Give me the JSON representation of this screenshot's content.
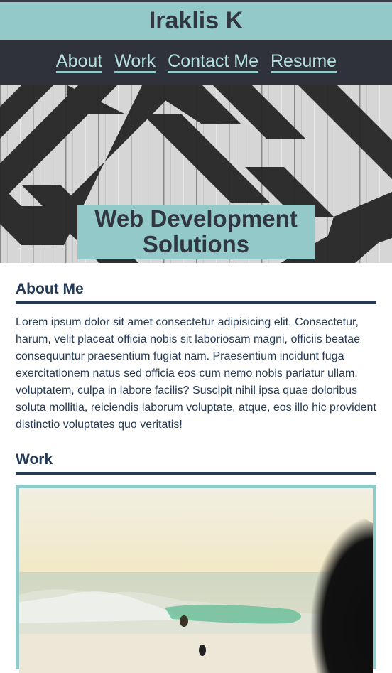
{
  "site": {
    "title": "Iraklis K"
  },
  "nav": {
    "items": [
      {
        "label": "About"
      },
      {
        "label": "Work"
      },
      {
        "label": "Contact Me"
      },
      {
        "label": "Resume"
      }
    ]
  },
  "hero": {
    "title": "Web Development Solutions"
  },
  "about": {
    "heading": "About Me",
    "body": "Lorem ipsum dolor sit amet consectetur adipisicing elit. Consectetur, harum, velit placeat officia nobis sit laboriosam magni, officiis beatae consequuntur praesentium fugiat nam. Praesentium incidunt fuga exercitationem natus sed officia eos cum nemo nobis pariatur ullam, voluptatem, culpa in labore facilis? Suscipit nihil ipsa quae doloribus soluta mollitia, reiciendis laborum voluptate, atque, eos illo hic provident distinctio voluptates quo veritatis!"
  },
  "work": {
    "heading": "Work"
  },
  "colors": {
    "accent": "#93c9c8",
    "nav_bg": "#2f313b",
    "heading": "#243a55",
    "title": "#313740"
  }
}
